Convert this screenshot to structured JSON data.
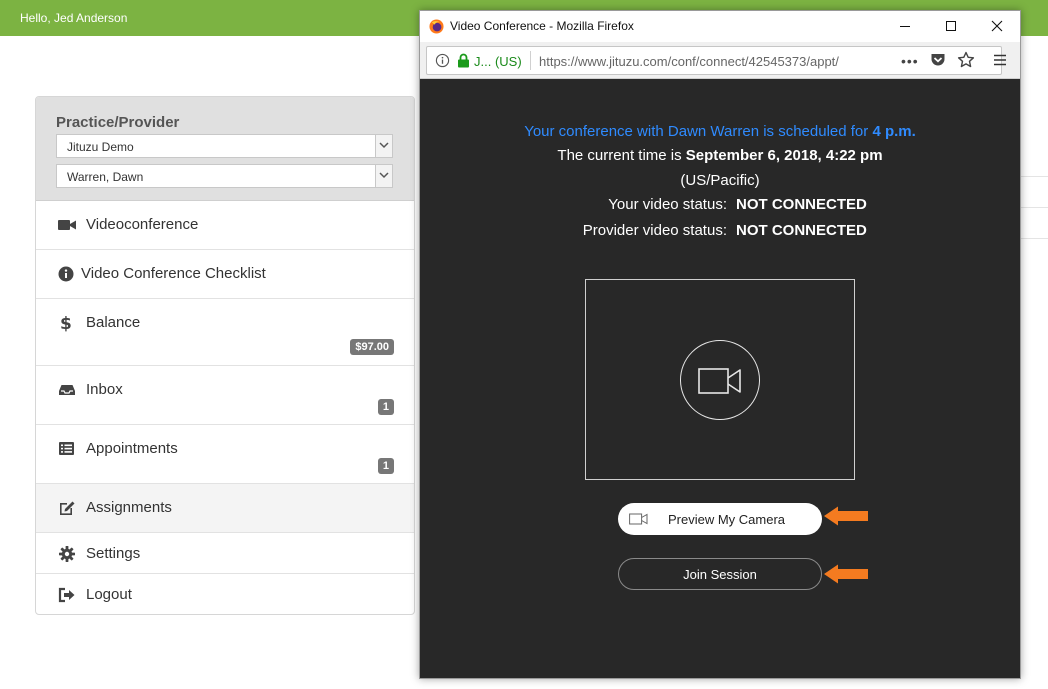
{
  "app": {
    "greeting": "Hello, Jed Anderson"
  },
  "sidebar": {
    "section_title": "Practice/Provider",
    "practice_select": {
      "value": "Jituzu Demo"
    },
    "provider_select": {
      "value": "Warren, Dawn"
    },
    "items": [
      {
        "label": "Videoconference",
        "icon": "video-camera-icon"
      },
      {
        "label": "Video Conference Checklist",
        "icon": "info-circle-icon"
      },
      {
        "label": "Balance",
        "icon": "dollar-icon",
        "badge": "$97.00"
      },
      {
        "label": "Inbox",
        "icon": "inbox-tray-icon",
        "badge": "1"
      },
      {
        "label": "Appointments",
        "icon": "list-icon",
        "badge": "1"
      },
      {
        "label": "Assignments",
        "icon": "edit-icon"
      },
      {
        "label": "Settings",
        "icon": "gear-icon"
      },
      {
        "label": "Logout",
        "icon": "sign-out-icon"
      }
    ]
  },
  "browser": {
    "window_title": "Video Conference - Mozilla Firefox",
    "site_identity": "J...  (US)",
    "url": "https://www.jituzu.com/conf/connect/42545373/appt/",
    "more_label": "•••"
  },
  "conference": {
    "schedule_text": "Your conference with Dawn Warren is scheduled for ",
    "schedule_time": "4 p.m.",
    "current_time_label": "The current time is ",
    "current_time_value": "September 6, 2018, 4:22 pm",
    "timezone": "(US/Pacific)",
    "your_status_label": "Your video status:",
    "your_status_value": "NOT CONNECTED",
    "provider_status_label": "Provider video status:",
    "provider_status_value": "NOT CONNECTED",
    "preview_button": "Preview My Camera",
    "join_button": "Join Session"
  },
  "colors": {
    "topbar": "#7cb342",
    "schedule_text": "#2f8bff",
    "content_bg": "#282828",
    "highlight_arrow": "#f47b20"
  }
}
